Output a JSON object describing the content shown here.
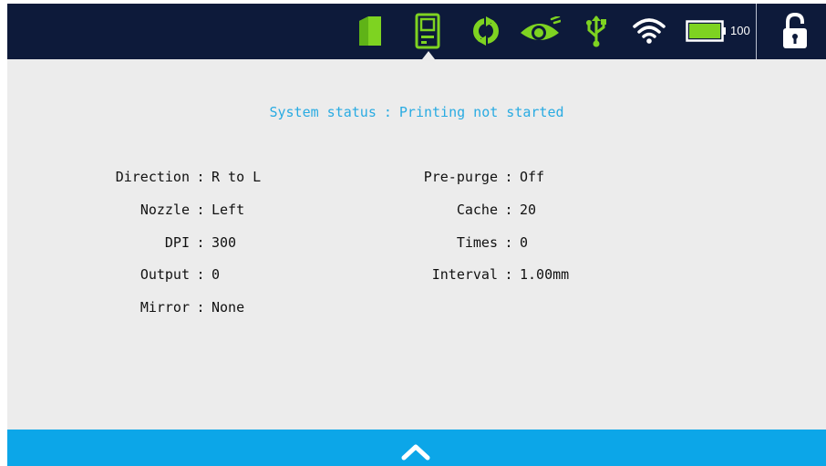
{
  "header": {
    "icons": [
      "ink-cartridge-icon",
      "printer-icon",
      "sync-icon",
      "eye-icon",
      "usb-icon",
      "wifi-icon",
      "battery-icon",
      "unlock-icon"
    ],
    "battery_level": "100",
    "battery_fraction": 1.0,
    "accent_color": "#7ed321",
    "bar_color": "#0d1a3a"
  },
  "status": {
    "label": "System status",
    "sep": ":",
    "value": "Printing not started",
    "color": "#29abe2"
  },
  "settings_left": [
    {
      "label": "Direction",
      "value": "R to L"
    },
    {
      "label": "Nozzle",
      "value": "Left"
    },
    {
      "label": "DPI",
      "value": "300"
    },
    {
      "label": "Output",
      "value": "0"
    },
    {
      "label": "Mirror",
      "value": "None"
    }
  ],
  "settings_right": [
    {
      "label": "Pre-purge",
      "value": "Off"
    },
    {
      "label": "Cache",
      "value": "20"
    },
    {
      "label": "Times",
      "value": "0"
    },
    {
      "label": "Interval",
      "value": "1.00mm"
    }
  ],
  "colon": ":",
  "footer": {
    "icon": "chevron-up-icon",
    "bar_color": "#0ca6e8"
  }
}
